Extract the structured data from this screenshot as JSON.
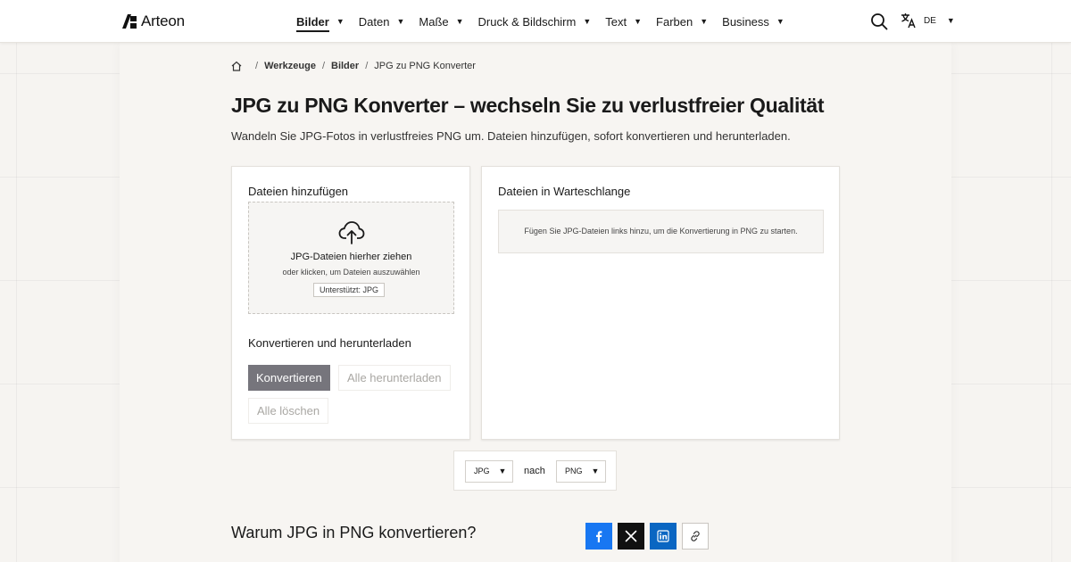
{
  "header": {
    "brand": "Arteon",
    "nav": [
      {
        "label": "Bilder",
        "active": true
      },
      {
        "label": "Daten"
      },
      {
        "label": "Maße"
      },
      {
        "label": "Druck & Bildschirm"
      },
      {
        "label": "Text"
      },
      {
        "label": "Farben"
      },
      {
        "label": "Business"
      }
    ],
    "caret": "▼",
    "search_icon": "search-icon",
    "language": "DE",
    "language_icon": "translate-icon"
  },
  "breadcrumb": {
    "home_icon": "home-icon",
    "sep": "/",
    "items": [
      "Werkzeuge",
      "Bilder",
      "JPG zu PNG Konverter"
    ]
  },
  "page": {
    "title": "JPG zu PNG Konverter – wechseln Sie zu verlustfreier Qualität",
    "subtitle": "Wandeln Sie JPG-Fotos in verlustfreies PNG um. Dateien hinzufügen, sofort konvertieren und herunterladen."
  },
  "upload": {
    "heading": "Dateien hinzufügen",
    "drop_icon": "cloud-upload-icon",
    "drop_title": "JPG-Dateien hierher ziehen",
    "drop_hint": "oder klicken, um Dateien auszuwählen",
    "supported": "Unterstützt: JPG"
  },
  "actions": {
    "heading": "Konvertieren und herunterladen",
    "convert": "Konvertieren",
    "download_all": "Alle herunterladen",
    "clear_all": "Alle löschen"
  },
  "queue": {
    "heading": "Dateien in Warteschlange",
    "empty": "Fügen Sie JPG-Dateien links hinzu, um die Konvertierung in PNG zu starten."
  },
  "format": {
    "from": "JPG",
    "to_word": "nach",
    "to": "PNG"
  },
  "why": {
    "heading": "Warum JPG in PNG konvertieren?"
  },
  "share": [
    {
      "icon": "facebook-icon",
      "color": "#1877f2"
    },
    {
      "icon": "x-icon",
      "color": "#111111"
    },
    {
      "icon": "linkedin-icon",
      "color": "#0a66c2"
    },
    {
      "icon": "link-icon",
      "color": "#ffffff"
    }
  ],
  "colors": {
    "primary_button": "#76757c",
    "background": "#f6f4f1"
  }
}
